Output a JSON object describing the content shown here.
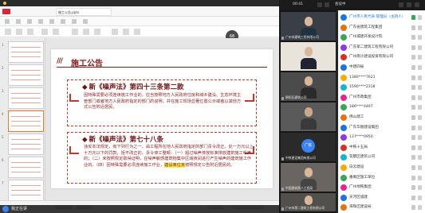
{
  "presentation": {
    "doc_tab": "施工公告.pptx",
    "zoom_badge": "68",
    "slide_title_mark": "///",
    "slide_title": "施工公告",
    "section1_heading": "新《噪声法》第四十三条第二款",
    "section1_text": "因特殊需要必须连续施工作业的，应当按照地方人民政府住房和城乡建设、生态环境主管部门或者地方人民政府指定的部门的说明，并在施工现场显著位置公示或者以其他方式公告附近居民。",
    "section2_heading": "新《噪声法》第七十八条",
    "section2_text_a": "违反本法规定，有下列行为之一，由工程所在地人民政府指定的部门责令改正，处一万元以上十万元以下的罚款，拒不改正的，责令停工整顿：（一）超过噪声排放标准排放建筑施工噪声的；（二）未按照规定取得证明，在噪声敏感建筑物集中区域夜间进行产生噪声的建筑施工作业的。（四）因特殊需要必须连续施工作业，",
    "section2_highlight": "建设单位未",
    "section2_text_b": "按照规定公告附近居民的。",
    "thumb_numbers": [
      "1",
      "2",
      "3",
      "4",
      "5",
      "6",
      "7"
    ]
  },
  "taskbar": {
    "label": "我正在讲"
  },
  "meeting": {
    "top_time": "00:41",
    "top_title": "会议中",
    "video_tiles": [
      {
        "name": "广州市建筑工程有限公司",
        "type": "video"
      },
      {
        "name": "",
        "type": "video"
      },
      {
        "name": "朝阳区建筑公司",
        "type": "video"
      },
      {
        "name": "",
        "type": "video"
      },
      {
        "name": "中铁建设集团有限公司",
        "type": "avatar",
        "avatar": "广铁"
      },
      {
        "name": "中国建筑第八工程局",
        "type": "video"
      },
      {
        "name": "广州市第二建筑工程有限公司",
        "type": "video"
      }
    ],
    "participants": [
      {
        "name": "广州市人民代表 管理员（主持人）",
        "host": true,
        "color": "#1a73e8",
        "mic": true
      },
      {
        "name": "广东省建筑工程集团",
        "host": false,
        "color": "#e8710a",
        "mic": false
      },
      {
        "name": "广州城建开发设计院",
        "host": false,
        "color": "#34a853",
        "mic": false
      },
      {
        "name": "广东第二建筑工程有限公司",
        "host": false,
        "color": "#9334e6",
        "mic": false
      },
      {
        "name": "广州南沙建设投资有限公司",
        "host": false,
        "color": "#d93025",
        "mic": false
      },
      {
        "name": "中建四局",
        "host": false,
        "color": "#1a73e8",
        "mic": false
      },
      {
        "name": "1380****7621",
        "host": false,
        "color": "#f9ab00",
        "mic": false
      },
      {
        "name": "1590****2318",
        "host": false,
        "color": "#12b5cb",
        "mic": false
      },
      {
        "name": "广州市政集团",
        "host": false,
        "color": "#e52592",
        "mic": false
      },
      {
        "name": "186****4497",
        "host": false,
        "color": "#34a853",
        "mic": false
      },
      {
        "name": "佛山建工",
        "host": false,
        "color": "#e8710a",
        "mic": false
      },
      {
        "name": "广东华隧建设集团",
        "host": false,
        "color": "#1a73e8",
        "mic": false
      },
      {
        "name": "137****0950",
        "host": false,
        "color": "#9334e6",
        "mic": false
      },
      {
        "name": "中铁十五局",
        "host": false,
        "color": "#d93025",
        "mic": false
      },
      {
        "name": "花都区建筑公司",
        "host": false,
        "color": "#12b5cb",
        "mic": false
      },
      {
        "name": "白云建设",
        "host": false,
        "color": "#f9ab00",
        "mic": false
      },
      {
        "name": "番禺区施工单位",
        "host": false,
        "color": "#34a853",
        "mic": false
      },
      {
        "name": "广州地铁集团",
        "host": false,
        "color": "#e52592",
        "mic": false
      },
      {
        "name": "天河区城建",
        "host": false,
        "color": "#1a73e8",
        "mic": false
      },
      {
        "name": "海珠区建设局",
        "host": false,
        "color": "#e8710a",
        "mic": false
      }
    ]
  }
}
